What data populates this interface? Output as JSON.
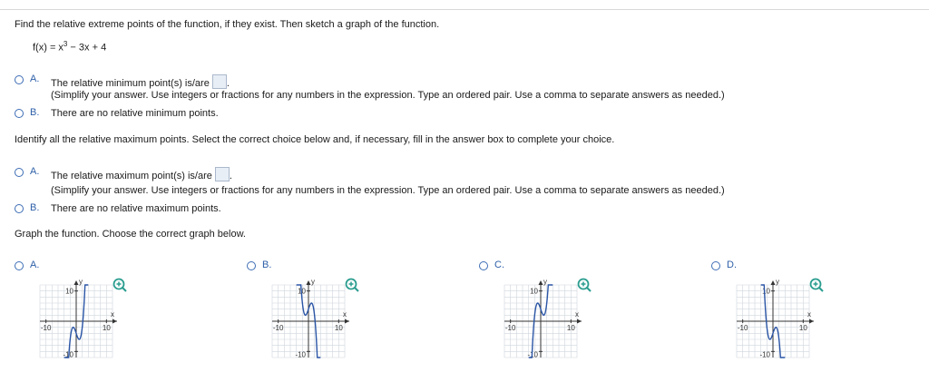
{
  "question": {
    "instruction": "Find the relative extreme points of the function, if they exist. Then sketch a graph of the function.",
    "function_text": "f(x) = x",
    "function_exp": "3",
    "function_tail": " − 3x + 4"
  },
  "part_min": {
    "option_a_letter": "A.",
    "option_a_text": "The relative minimum point(s) is/are",
    "hint": "(Simplify your answer. Use integers or fractions for any numbers in the expression. Type an ordered pair. Use a comma to separate answers as needed.)",
    "option_b_letter": "B.",
    "option_b_text": "There are no relative minimum points."
  },
  "part_max_prompt": "Identify all the relative maximum points. Select the correct choice below and, if necessary, fill in the answer box to complete your choice.",
  "part_max": {
    "option_a_letter": "A.",
    "option_a_text": "The relative maximum point(s) is/are",
    "hint": "(Simplify your answer. Use integers or fractions for any numbers in the expression. Type an ordered pair. Use a comma to separate answers as needed.)",
    "option_b_letter": "B.",
    "option_b_text": "There are no relative maximum points."
  },
  "graph_prompt": "Graph the function. Choose the correct graph below.",
  "graph_options": [
    {
      "letter": "A.",
      "variant": "x^3-3x-4 shape"
    },
    {
      "letter": "B.",
      "variant": "-x^3+3x+4 shape"
    },
    {
      "letter": "C.",
      "variant": "x^3-3x+4 shape"
    },
    {
      "letter": "D.",
      "variant": "-x^3+3x-4 shape"
    }
  ],
  "axis_labels": {
    "x": "x",
    "y": "y",
    "pos": "10",
    "neg": "-10"
  },
  "colors": {
    "accent": "#2d5fa8",
    "curve": "#2a55a6",
    "grid": "#cfd6dd",
    "zoom": "#2a9d8f"
  }
}
